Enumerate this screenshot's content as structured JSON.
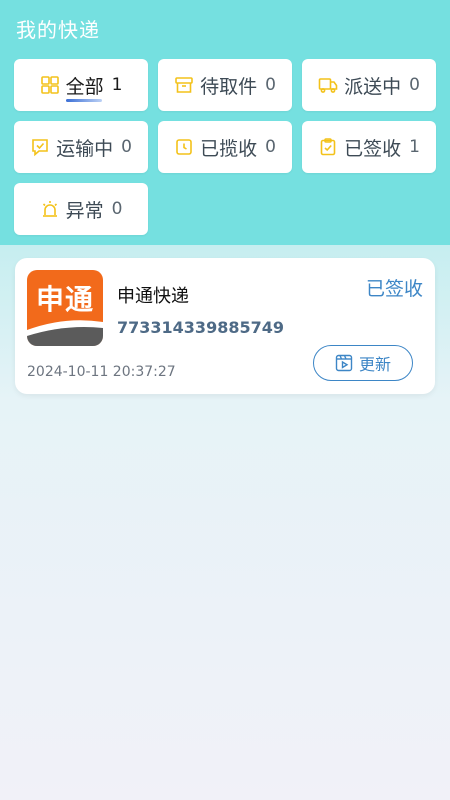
{
  "header": {
    "title": "我的快递"
  },
  "filters": [
    {
      "label": "全部",
      "count": "1",
      "icon": "grid-icon",
      "active": true
    },
    {
      "label": "待取件",
      "count": "0",
      "icon": "package-box-icon"
    },
    {
      "label": "派送中",
      "count": "0",
      "icon": "truck-icon"
    },
    {
      "label": "运输中",
      "count": "0",
      "icon": "transit-icon"
    },
    {
      "label": "已揽收",
      "count": "0",
      "icon": "collected-icon"
    },
    {
      "label": "已签收",
      "count": "1",
      "icon": "clipboard-check-icon"
    },
    {
      "label": "异常",
      "count": "0",
      "icon": "alarm-light-icon"
    }
  ],
  "shipments": [
    {
      "logo_text": "申通",
      "company": "申通快递",
      "tracking_number": "773314339885749",
      "status": "已签收",
      "timestamp": "2024-10-11 20:37:27",
      "update_label": "更新"
    }
  ],
  "colors": {
    "header_bg": "#75e0e0",
    "accent_blue": "#3d86c6",
    "icon_yellow": "#f3c21a",
    "logo_orange": "#f26a1b"
  }
}
